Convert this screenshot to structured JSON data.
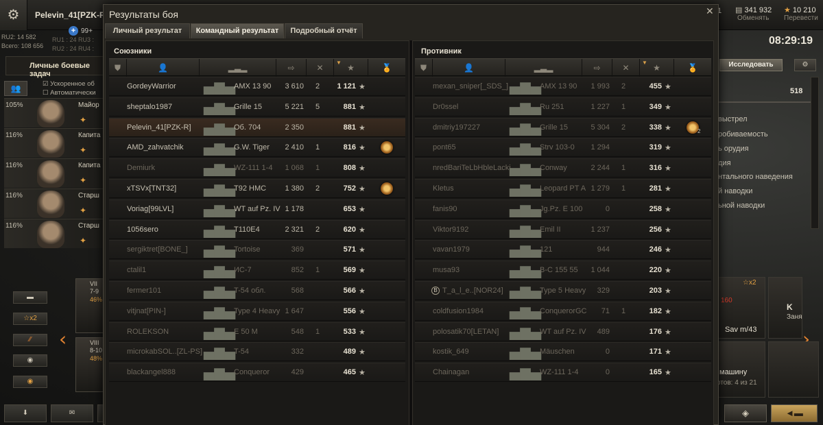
{
  "topbar": {
    "player_name": "Pelevin_41[PZK-R]",
    "premium_label": "99+",
    "gold_value": "341 932",
    "gold_label": "Обменять",
    "credits_value": "10 210",
    "credits_label": "Перевести",
    "player_extra": "1"
  },
  "left": {
    "stats": [
      "RU2: 14 582",
      "Всего: 108 656"
    ],
    "servers": [
      "RU1 : 24  RU3 :",
      "RU2 : 24  RU4 :"
    ],
    "missions_label": "Личные боевые задач",
    "options": [
      "Ускоренное об",
      "Автоматически"
    ],
    "crew": [
      {
        "pct": "105%",
        "rank": "Майор"
      },
      {
        "pct": "116%",
        "rank": "Капита"
      },
      {
        "pct": "116%",
        "rank": "Капита"
      },
      {
        "pct": "116%",
        "rank": "Старш"
      },
      {
        "pct": "116%",
        "rank": "Старш"
      }
    ],
    "buttons": [
      "",
      "☆x2",
      "",
      "",
      ""
    ],
    "tank_cards": [
      {
        "tier": "VII",
        "range": "7-9",
        "pct": "46%"
      },
      {
        "tier": "VIII",
        "range": "8-10",
        "pct": "48%"
      }
    ]
  },
  "right": {
    "clock": "08:29:19",
    "research_label": "Исследовать",
    "stat_value": "518",
    "stat_lines": [
      "выстрел",
      "робиваемость",
      "ь орудия",
      "дия",
      "нтального наведения",
      "й наводки",
      "ьной наводки"
    ],
    "card_badge": "☆x2",
    "card_num": "160",
    "card_k": "K",
    "card_k2": "Заня",
    "vehicle_name": "Sav m/43",
    "buy_label": "машину",
    "slots_label": "отов: 4 из 21"
  },
  "dialog": {
    "title": "Результаты боя",
    "tabs": [
      "Личный результат",
      "Командный результат",
      "Подробный отчёт"
    ],
    "active_tab": 1,
    "allies_title": "Союзники",
    "enemies_title": "Противник"
  },
  "allies": [
    {
      "name": "GordeyWarrior",
      "tank": "AMX 13 90",
      "dmg": "3 610",
      "kills": "2",
      "xp": "1 121",
      "alive": true
    },
    {
      "name": "sheptalo1987",
      "tank": "Grille 15",
      "dmg": "5 221",
      "kills": "5",
      "xp": "881",
      "alive": true
    },
    {
      "name": "Pelevin_41[PZK-R]",
      "tank": "Об. 704",
      "dmg": "2 350",
      "kills": "",
      "xp": "881",
      "alive": true,
      "me": true
    },
    {
      "name": "AMD_zahvatchik",
      "tank": "G.W. Tiger",
      "dmg": "2 410",
      "kills": "1",
      "xp": "816",
      "alive": true,
      "medal": true
    },
    {
      "name": "Demiurk",
      "tank": "WZ-111 1-4",
      "dmg": "1 068",
      "kills": "1",
      "xp": "808",
      "alive": false
    },
    {
      "name": "xTSVx[TNT32]",
      "tank": "T92 HMC",
      "dmg": "1 380",
      "kills": "2",
      "xp": "752",
      "alive": true,
      "medal": true
    },
    {
      "name": "Voriag[99LVL]",
      "tank": "WT auf Pz. IV",
      "dmg": "1 178",
      "kills": "",
      "xp": "653",
      "alive": true
    },
    {
      "name": "1056sero",
      "tank": "T110E4",
      "dmg": "2 321",
      "kills": "2",
      "xp": "620",
      "alive": true
    },
    {
      "name": "sergiktret[BONE_]",
      "tank": "Tortoise",
      "dmg": "369",
      "kills": "",
      "xp": "571",
      "alive": false
    },
    {
      "name": "ctalil1",
      "tank": "ИС-7",
      "dmg": "852",
      "kills": "1",
      "xp": "569",
      "alive": false
    },
    {
      "name": "fermer101",
      "tank": "T-54 обл.",
      "dmg": "568",
      "kills": "",
      "xp": "566",
      "alive": false
    },
    {
      "name": "vitjnat[PIN-]",
      "tank": "Type 4 Heavy",
      "dmg": "1 647",
      "kills": "",
      "xp": "556",
      "alive": false
    },
    {
      "name": "ROLEKSON",
      "tank": "E 50 M",
      "dmg": "548",
      "kills": "1",
      "xp": "533",
      "alive": false
    },
    {
      "name": "microkabSOL..[ZL-PS]",
      "tank": "T-54",
      "dmg": "332",
      "kills": "",
      "xp": "489",
      "alive": false
    },
    {
      "name": "blackangel888",
      "tank": "Conqueror",
      "dmg": "429",
      "kills": "",
      "xp": "465",
      "alive": false
    }
  ],
  "enemies": [
    {
      "name": "mexan_sniper[_SDS_]",
      "tank": "AMX 13 90",
      "dmg": "1 993",
      "kills": "2",
      "xp": "455",
      "alive": false
    },
    {
      "name": "Dr0ssel",
      "tank": "Ru 251",
      "dmg": "1 227",
      "kills": "1",
      "xp": "349",
      "alive": false
    },
    {
      "name": "dmitriy197227",
      "tank": "Grille 15",
      "dmg": "5 304",
      "kills": "2",
      "xp": "338",
      "alive": false,
      "medal": true,
      "medal_count": "2"
    },
    {
      "name": "pont65",
      "tank": "Strv 103-0",
      "dmg": "1 294",
      "kills": "",
      "xp": "319",
      "alive": false
    },
    {
      "name": "nredBariTeLbHbleLacki",
      "tank": "Conway",
      "dmg": "2 244",
      "kills": "1",
      "xp": "316",
      "alive": false
    },
    {
      "name": "Kletus",
      "tank": "Leopard PT A",
      "dmg": "1 279",
      "kills": "1",
      "xp": "281",
      "alive": false
    },
    {
      "name": "fanis90",
      "tank": "Jg.Pz. E 100",
      "dmg": "0",
      "kills": "",
      "xp": "258",
      "alive": false
    },
    {
      "name": "Viktor9192",
      "tank": "Emil II",
      "dmg": "1 237",
      "kills": "",
      "xp": "256",
      "alive": false
    },
    {
      "name": "vavan1979",
      "tank": "121",
      "dmg": "944",
      "kills": "",
      "xp": "246",
      "alive": false
    },
    {
      "name": "musa93",
      "tank": "B-C 155 55",
      "dmg": "1 044",
      "kills": "",
      "xp": "220",
      "alive": false
    },
    {
      "name": "T_a_l_e..[NOR24]",
      "tank": "Type 5 Heavy",
      "dmg": "329",
      "kills": "",
      "xp": "203",
      "alive": false,
      "clan": "B"
    },
    {
      "name": "coldfusion1984",
      "tank": "ConquerorGC",
      "dmg": "71",
      "kills": "1",
      "xp": "182",
      "alive": false
    },
    {
      "name": "polosatik70[LETAN]",
      "tank": "WT auf Pz. IV",
      "dmg": "489",
      "kills": "",
      "xp": "176",
      "alive": false
    },
    {
      "name": "kostik_649",
      "tank": "Mäuschen",
      "dmg": "0",
      "kills": "",
      "xp": "171",
      "alive": false
    },
    {
      "name": "Chainagan",
      "tank": "WZ-111 1-4",
      "dmg": "0",
      "kills": "",
      "xp": "165",
      "alive": false
    }
  ]
}
